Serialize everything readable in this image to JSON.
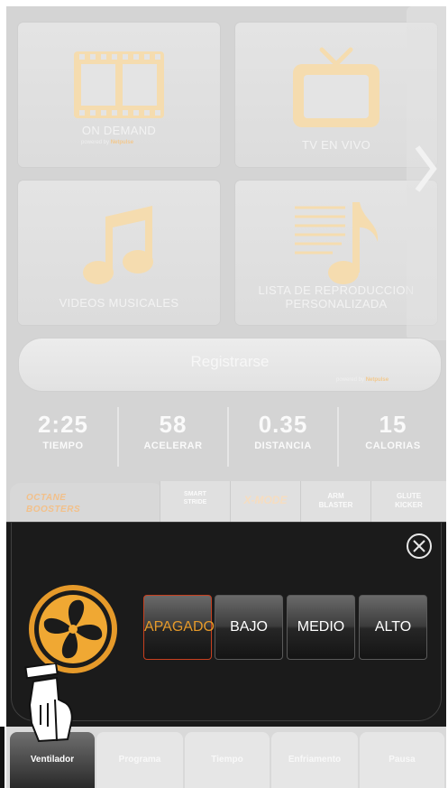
{
  "tiles": [
    {
      "label": "ON DEMAND",
      "powered_prefix": "powered by",
      "powered_brand": "Netpulse",
      "icon": "film-icon"
    },
    {
      "label": "TV EN VIVO",
      "icon": "tv-icon"
    },
    {
      "label": "VIDEOS MUSICALES",
      "icon": "music-note-icon"
    },
    {
      "label": "LISTA DE REPRODUCCION PERSONALIZADA",
      "icon": "playlist-icon"
    }
  ],
  "register": {
    "label": "Registrarse",
    "powered_prefix": "powered by",
    "powered_brand": "Netpulse"
  },
  "stats": [
    {
      "value": "2:25",
      "label": "TIEMPO"
    },
    {
      "value": "58",
      "label": "ACELERAR"
    },
    {
      "value": "0.35",
      "label": "DISTANCIA"
    },
    {
      "value": "15",
      "label": "CALORIAS"
    }
  ],
  "boosters": {
    "title_line1": "OCTANE",
    "title_line2": "BOOSTERS",
    "tabs": [
      "SMART STRIDE",
      "X-MODE",
      "ARM BLASTER",
      "GLUTE KICKER"
    ]
  },
  "fan_panel": {
    "options": [
      "APAGADO",
      "BAJO",
      "MEDIO",
      "ALTO"
    ],
    "selected": "APAGADO",
    "accent_color": "#e69a2a"
  },
  "bottom_nav": {
    "items": [
      "Ventilador",
      "Programa",
      "Tiempo",
      "Enfriamento",
      "Pausa"
    ],
    "active": "Ventilador"
  }
}
